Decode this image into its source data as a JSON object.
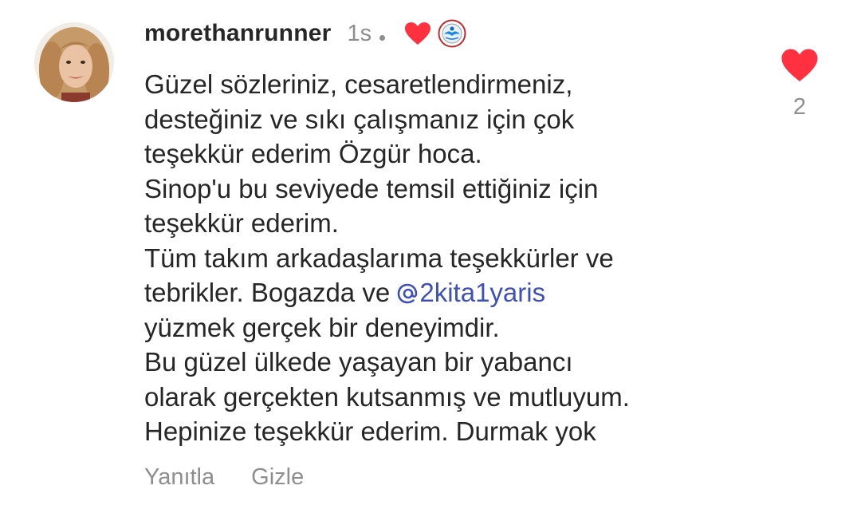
{
  "comment": {
    "username": "morethanrunner",
    "timestamp": "1s",
    "mention": "@2kita1yaris",
    "lines": [
      "Güzel sözleriniz, cesaretlendirmeniz,",
      "desteğiniz ve sıkı çalışmanız için çok",
      "teşekkür ederim Özgür hoca.",
      "Sinop'u bu seviyede temsil ettiğiniz için",
      "teşekkür ederim.",
      "Tüm takım arkadaşlarıma teşekkürler ve",
      "tebrikler. Bogazda ve ",
      "yüzmek gerçek bir deneyimdir.",
      "Bu güzel ülkede yaşayan bir yabancı",
      "olarak gerçekten kutsanmış ve mutluyum.",
      "Hepinize teşekkür ederim. Durmak yok"
    ],
    "mention_text": "2kita1yaris",
    "like_count": "2"
  },
  "actions": {
    "reply_label": "Yanıtla",
    "hide_label": "Gizle"
  },
  "icons": {
    "liked_by_author": "heart-icon",
    "team_badge": "badge-icon",
    "like": "heart-icon",
    "mention": "threads-at-icon"
  },
  "colors": {
    "heart": "#ff3040",
    "mention": "#3f51b5",
    "muted": "#8e8e8e",
    "text": "#262626"
  }
}
